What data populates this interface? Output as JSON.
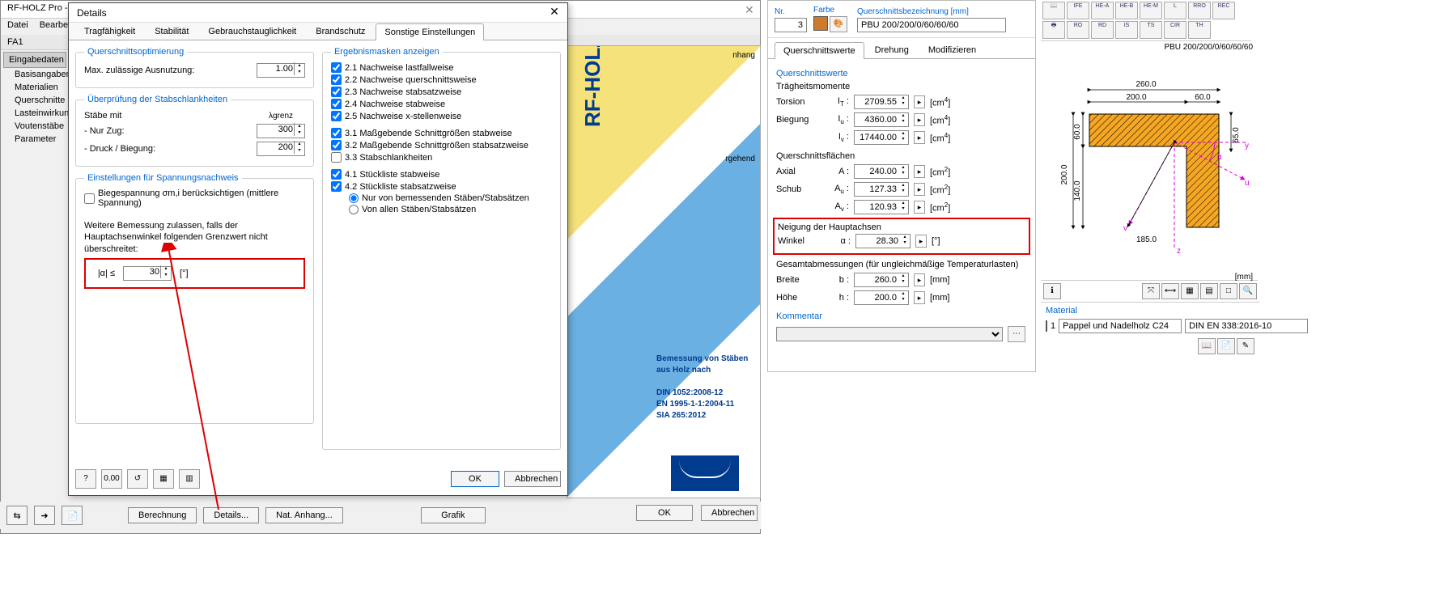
{
  "app": {
    "title": "RF-HOLZ Pro - [W",
    "fa_label": "FA1"
  },
  "menu": [
    "Datei",
    "Bearbeite"
  ],
  "sidebar": {
    "header": "Eingabedaten",
    "items": [
      "Basisangaben",
      "Materialien",
      "Querschnitte",
      "Lasteinwirkung",
      "Voutenstäbe",
      "Parameter"
    ]
  },
  "dialog": {
    "title": "Details",
    "tabs": [
      "Tragfähigkeit",
      "Stabilität",
      "Gebrauchstauglichkeit",
      "Brandschutz",
      "Sonstige Einstellungen"
    ],
    "active_tab": 4,
    "qopt": {
      "title": "Querschnittsoptimierung",
      "label": "Max. zulässige Ausnutzung:",
      "value": "1.00"
    },
    "schlank": {
      "title": "Überprüfung der Stabschlankheiten",
      "col_header": "λgrenz",
      "rows": [
        {
          "label": "Stäbe mit",
          "value": ""
        },
        {
          "label": "- Nur Zug:",
          "value": "300"
        },
        {
          "label": "- Druck / Biegung:",
          "value": "200"
        }
      ]
    },
    "spannung": {
      "title": "Einstellungen für Spannungsnachweis",
      "chk_label": "Biegespannung σm,i berücksichtigen (mittlere Spannung)",
      "desc": "Weitere Bemessung zulassen, falls der Hauptachsenwinkel folgenden Grenzwert nicht überschreitet:",
      "alpha_label": "|α| ≤",
      "alpha_value": "30",
      "alpha_unit": "[°]"
    },
    "masks": {
      "title": "Ergebnismasken anzeigen",
      "items": [
        {
          "label": "2.1 Nachweise lastfallweise",
          "checked": true
        },
        {
          "label": "2.2 Nachweise querschnittsweise",
          "checked": true
        },
        {
          "label": "2.3 Nachweise stabsatzweise",
          "checked": true
        },
        {
          "label": "2.4 Nachweise stabweise",
          "checked": true
        },
        {
          "label": "2.5 Nachweise x-stellenweise",
          "checked": true
        },
        {
          "label": "3.1 Maßgebende Schnittgrößen stabweise",
          "checked": true
        },
        {
          "label": "3.2 Maßgebende Schnittgrößen stabsatzweise",
          "checked": true
        },
        {
          "label": "3.3 Stabschlankheiten",
          "checked": false
        },
        {
          "label": "4.1 Stückliste stabweise",
          "checked": true
        },
        {
          "label": "4.2 Stückliste stabsatzweise",
          "checked": true
        }
      ],
      "radios": [
        "Nur von bemessenden Stäben/Stabsätzen",
        "Von allen Stäben/Stabsätzen"
      ]
    },
    "buttons": {
      "ok": "OK",
      "cancel": "Abbrechen"
    }
  },
  "brand": {
    "rotated": "RF-HOLZ Pro",
    "text1": "Bemessung von Stäben aus Holz nach",
    "text2": "DIN 1052:2008-12\nEN 1995-1-1:2004-11\nSIA 265:2012",
    "nat_anhang": "Nat. Anhang…",
    "gehend": "rgehend"
  },
  "bottom": {
    "berechnung": "Berechnung",
    "details": "Details...",
    "nat": "Nat. Anhang...",
    "grafik": "Grafik",
    "ok": "OK",
    "cancel": "Abbrechen"
  },
  "rpanel": {
    "hdr": {
      "nr_label": "Nr.",
      "nr_value": "3",
      "farbe_label": "Farbe",
      "bez_label": "Querschnittsbezeichnung [mm]",
      "bez_value": "PBU 200/200/0/60/60/60"
    },
    "tabs": [
      "Querschnittswerte",
      "Drehung",
      "Modifizieren"
    ],
    "g_qw": "Querschnittswerte",
    "g_tm": "Trägheitsmomente",
    "torsion": {
      "lbl": "Torsion",
      "sym": "IT :",
      "val": "2709.55",
      "u": "[cm4]"
    },
    "biegung": {
      "lbl": "Biegung",
      "sym": "Iu :",
      "val": "4360.00",
      "u": "[cm4]"
    },
    "iv": {
      "sym": "Iv :",
      "val": "17440.00",
      "u": "[cm4]"
    },
    "g_qf": "Querschnittsflächen",
    "axial": {
      "lbl": "Axial",
      "sym": "A :",
      "val": "240.00",
      "u": "[cm2]"
    },
    "schub_u": {
      "lbl": "Schub",
      "sym": "Au :",
      "val": "127.33",
      "u": "[cm2]"
    },
    "schub_v": {
      "sym": "Av :",
      "val": "120.93",
      "u": "[cm2]"
    },
    "g_nh": "Neigung der Hauptachsen",
    "winkel": {
      "lbl": "Winkel",
      "sym": "α :",
      "val": "28.30",
      "u": "[°]"
    },
    "g_ga": "Gesamtabmessungen (für ungleichmäßige Temperaturlasten)",
    "breite": {
      "lbl": "Breite",
      "sym": "b :",
      "val": "260.0",
      "u": "[mm]"
    },
    "hoehe": {
      "lbl": "Höhe",
      "sym": "h :",
      "val": "200.0",
      "u": "[mm]"
    },
    "g_kom": "Kommentar"
  },
  "far_right": {
    "toolbar_labels": [
      "📖",
      "IFE",
      "HE-A",
      "HE-B",
      "HE-M",
      "L",
      "RRO",
      "REC",
      "🖶",
      "RO",
      "RD",
      "IS",
      "TS",
      "CIR",
      "TH"
    ],
    "draw_title": "PBU 200/200/0/60/60/60",
    "mm": "[mm]",
    "dims": {
      "w_total": "260.0",
      "w_main": "200.0",
      "w_right": "60.0",
      "h_total": "200.0",
      "h_inner": "140.0",
      "h_top": "60.0",
      "h_right": "65.0",
      "diag": "185.0"
    },
    "material_hdr": "Material",
    "material_idx": "1",
    "material_name": "Pappel und Nadelholz C24",
    "material_std": "DIN EN 338:2016-10"
  }
}
